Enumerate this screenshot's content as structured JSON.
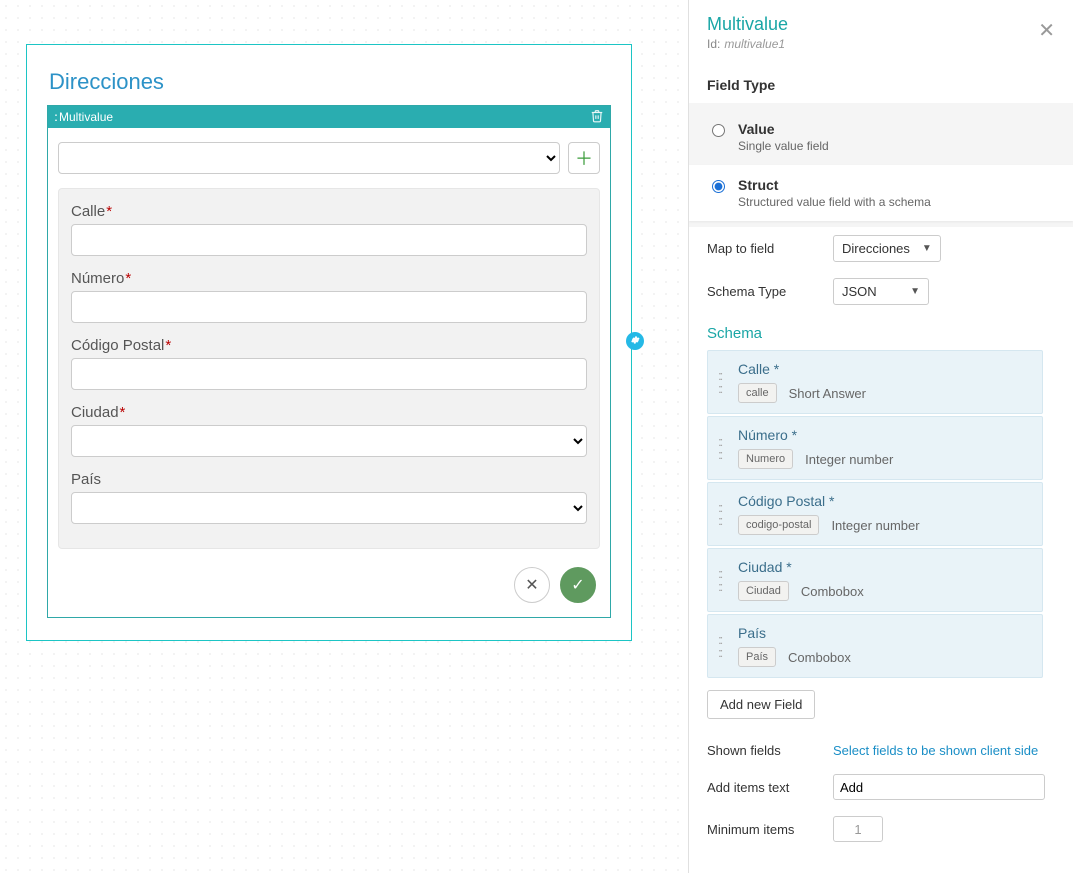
{
  "canvas": {
    "section_title": "Direcciones",
    "multivalue_label": "Multivalue",
    "fields": [
      {
        "label": "Calle",
        "required": true,
        "kind": "text"
      },
      {
        "label": "Número",
        "required": true,
        "kind": "text"
      },
      {
        "label": "Código Postal",
        "required": true,
        "kind": "text"
      },
      {
        "label": "Ciudad",
        "required": true,
        "kind": "select"
      },
      {
        "label": "País",
        "required": false,
        "kind": "select"
      }
    ]
  },
  "panel": {
    "title": "Multivalue",
    "id_label": "Id:",
    "id_value": "multivalue1",
    "field_type_heading": "Field Type",
    "radio": {
      "value": {
        "title": "Value",
        "desc": "Single value field"
      },
      "struct": {
        "title": "Struct",
        "desc": "Structured value field with a schema",
        "selected": true
      }
    },
    "map_to_field_label": "Map to field",
    "map_to_field_value": "Direcciones",
    "schema_type_label": "Schema Type",
    "schema_type_value": "JSON",
    "schema_heading": "Schema",
    "schema": [
      {
        "title": "Calle *",
        "chip": "calle",
        "type": "Short Answer"
      },
      {
        "title": "Número *",
        "chip": "Numero",
        "type": "Integer number"
      },
      {
        "title": "Código Postal *",
        "chip": "codigo-postal",
        "type": "Integer number"
      },
      {
        "title": "Ciudad *",
        "chip": "Ciudad",
        "type": "Combobox"
      },
      {
        "title": "País",
        "chip": "País",
        "type": "Combobox"
      }
    ],
    "add_field_label": "Add new Field",
    "shown_fields_label": "Shown fields",
    "shown_fields_placeholder": "Select fields to be shown client side",
    "add_items_text_label": "Add items text",
    "add_items_text_value": "Add",
    "minimum_items_label": "Minimum items",
    "minimum_items_value": "1"
  }
}
